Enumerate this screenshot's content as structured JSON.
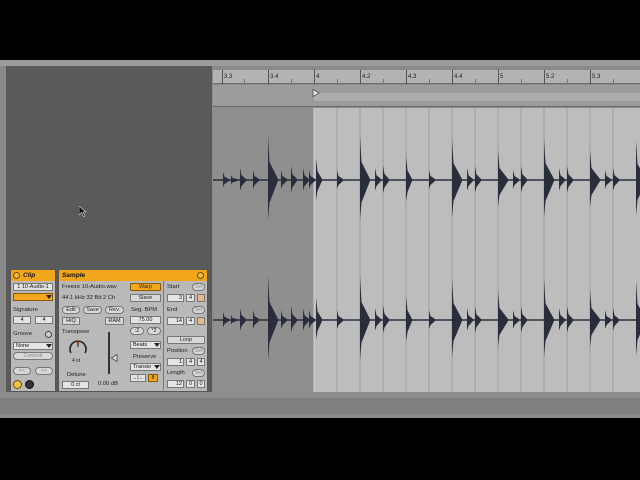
{
  "ruler": {
    "labels": [
      "3.3",
      "3.4",
      "4",
      "4.2",
      "4.3",
      "4.4",
      "5",
      "5.2",
      "5.3"
    ]
  },
  "clip": {
    "title": "Clip",
    "name": "1 10-Audio-1",
    "signature_label": "Signature",
    "sig_num": "4",
    "sig_den": "4",
    "groove_label": "Groove",
    "groove_value": "None",
    "commit_label": "Commit",
    "nav_left": "<<",
    "nav_right": ">>"
  },
  "sample": {
    "title": "Sample",
    "file": "Freeze 10-Audio.wav",
    "info": "44.1 kHz 32 Bit 2 Ch",
    "edit_label": "Edit",
    "save_label": "Save",
    "rev_label": "Rev.",
    "hiq_label": "HiQ",
    "ram_label": "RAM",
    "transpose_label": "Transpose",
    "transpose_value": "4 st",
    "detune_label": "Detune",
    "detune_value": "0 ct",
    "gain_value": "0.00 dB",
    "warp_label": "Warp",
    "slave_label": "Slave",
    "seg_bpm_label": "Seg. BPM",
    "seg_bpm_value": "75.00",
    "half_label": ":2",
    "double_label": "*2",
    "warp_mode": "Beats",
    "preserve_label": "Preserve",
    "preserve_value": "Transie",
    "loop_mode": "→|←",
    "loop_mode_num": "8"
  },
  "markers": {
    "start_label": "Start",
    "start_bar": "3",
    "start_beat": "4",
    "end_label": "End",
    "end_bar": "14",
    "end_beat": "4",
    "set_label": "Set",
    "loop_label": "Loop",
    "position_label": "Position",
    "pos_bar": "1",
    "pos_beat": "4",
    "pos_six": "4",
    "length_label": "Length",
    "len_bar": "12",
    "len_beat": "0",
    "len_six": "0"
  }
}
